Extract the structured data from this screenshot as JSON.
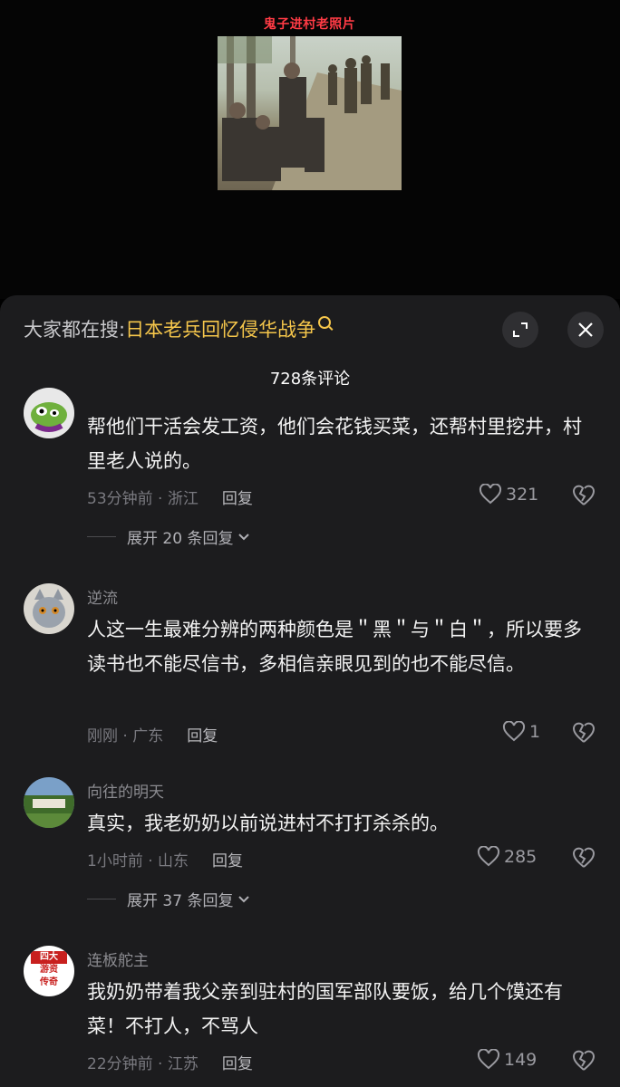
{
  "video": {
    "caption": "鬼子进村老照片"
  },
  "sheet": {
    "search_prefix": "大家都在搜:",
    "search_term": "日本老兵回忆侵华战争",
    "comment_count": "728条评论"
  },
  "comments": [
    {
      "username": "",
      "text": "帮他们干活会发工资，他们会花钱买菜，还帮村里挖井，村里老人说的。",
      "time_location": "53分钟前 · 浙江",
      "reply_label": "回复",
      "likes": "321",
      "expand_label": "展开 20 条回复"
    },
    {
      "username": "逆流",
      "text": "人这一生最难分辨的两种颜色是＂黑＂与＂白＂，所以要多读书也不能尽信书，多相信亲眼见到的也不能尽信。",
      "time_location": "刚刚 · 广东",
      "reply_label": "回复",
      "likes": "1"
    },
    {
      "username": "向往的明天",
      "text": "真实，我老奶奶以前说进村不打打杀杀的。",
      "time_location": "1小时前 · 山东",
      "reply_label": "回复",
      "likes": "285",
      "expand_label": "展开 37 条回复"
    },
    {
      "username": "连板舵主",
      "avatar_text": [
        "四大",
        "游资",
        "传奇"
      ],
      "text": "我奶奶带着我父亲到驻村的国军部队要饭，给几个馍还有菜！不打人，不骂人",
      "time_location": "22分钟前 · 江苏",
      "reply_label": "回复",
      "likes": "149"
    }
  ],
  "icons": [
    "expand-icon",
    "close-icon",
    "heart-icon",
    "broken-heart-icon",
    "chevron-down-icon",
    "search-icon"
  ]
}
